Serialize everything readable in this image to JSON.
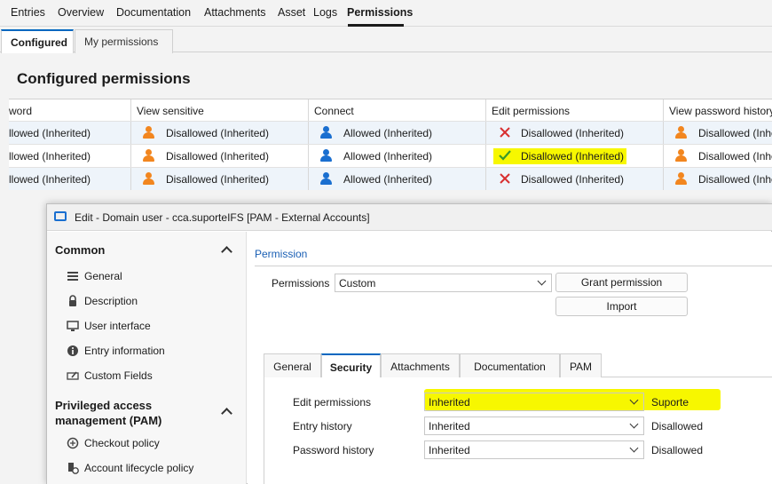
{
  "top_nav": {
    "items": [
      {
        "label": "Entries"
      },
      {
        "label": "Overview"
      },
      {
        "label": "Documentation"
      },
      {
        "label": "Attachments"
      },
      {
        "label": "Asset"
      },
      {
        "label": "Logs"
      },
      {
        "label": "Permissions",
        "active": true
      }
    ]
  },
  "sub_tabs": [
    {
      "label": "Configured",
      "active": true
    },
    {
      "label": "My permissions"
    }
  ],
  "section_title": "Configured permissions",
  "grid": {
    "columns": [
      "word",
      "View sensitive",
      "Connect",
      "Edit permissions",
      "View password history"
    ],
    "rows": [
      {
        "cells": [
          {
            "text": "llowed (Inherited)"
          },
          {
            "text": "Disallowed (Inherited)",
            "icon": "person-orange-icon"
          },
          {
            "text": "Allowed (Inherited)",
            "icon": "person-blue-icon"
          },
          {
            "text": "Disallowed (Inherited)",
            "icon": "red-x-icon"
          },
          {
            "text": "Disallowed (Inhe",
            "icon": "person-orange-icon"
          }
        ]
      },
      {
        "cells": [
          {
            "text": "llowed (Inherited)"
          },
          {
            "text": "Disallowed (Inherited)",
            "icon": "person-orange-icon"
          },
          {
            "text": "Allowed (Inherited)",
            "icon": "person-blue-icon"
          },
          {
            "text": "Disallowed (Inherited)",
            "icon": "green-check-icon",
            "highlight": true
          },
          {
            "text": "Disallowed (Inhe",
            "icon": "person-orange-icon"
          }
        ]
      },
      {
        "cells": [
          {
            "text": "llowed (Inherited)"
          },
          {
            "text": "Disallowed (Inherited)",
            "icon": "person-orange-icon"
          },
          {
            "text": "Allowed (Inherited)",
            "icon": "person-blue-icon"
          },
          {
            "text": "Disallowed (Inherited)",
            "icon": "red-x-icon"
          },
          {
            "text": "Disallowed (Inhe",
            "icon": "person-orange-icon"
          }
        ]
      }
    ]
  },
  "dialog": {
    "title": "Edit - Domain user - cca.suporteIFS [PAM - External Accounts]",
    "sidebar": {
      "common_heading": "Common",
      "common_items": [
        {
          "label": "General",
          "icon": "list-icon"
        },
        {
          "label": "Description",
          "icon": "lock-icon"
        },
        {
          "label": "User interface",
          "icon": "monitor-icon"
        },
        {
          "label": "Entry information",
          "icon": "info-icon"
        },
        {
          "label": "Custom Fields",
          "icon": "edit-field-icon"
        }
      ],
      "pam_heading": "Privileged access management (PAM)",
      "pam_items": [
        {
          "label": "Checkout policy",
          "icon": "checkout-icon"
        },
        {
          "label": "Account lifecycle policy",
          "icon": "lifecycle-icon"
        }
      ]
    },
    "content": {
      "section_header": "Permission",
      "permissions_label": "Permissions",
      "permissions_value": "Custom",
      "grant_button": "Grant permission",
      "import_button": "Import",
      "tabs": [
        {
          "label": "General"
        },
        {
          "label": "Security",
          "active": true
        },
        {
          "label": "Attachments"
        },
        {
          "label": "Documentation"
        },
        {
          "label": "PAM"
        }
      ],
      "security_rows": [
        {
          "name": "Edit permissions",
          "value": "Inherited",
          "effective": "Suporte",
          "highlight": true
        },
        {
          "name": "Entry history",
          "value": "Inherited",
          "effective": "Disallowed"
        },
        {
          "name": "Password history",
          "value": "Inherited",
          "effective": "Disallowed"
        }
      ]
    }
  },
  "colors": {
    "accent": "#0067c0",
    "link_blue": "#1a5fb4",
    "highlight_yellow": "#f7f700",
    "orange": "#f2861f",
    "blue": "#1a6fd0",
    "red": "#d83030",
    "green": "#3a9a2a"
  }
}
